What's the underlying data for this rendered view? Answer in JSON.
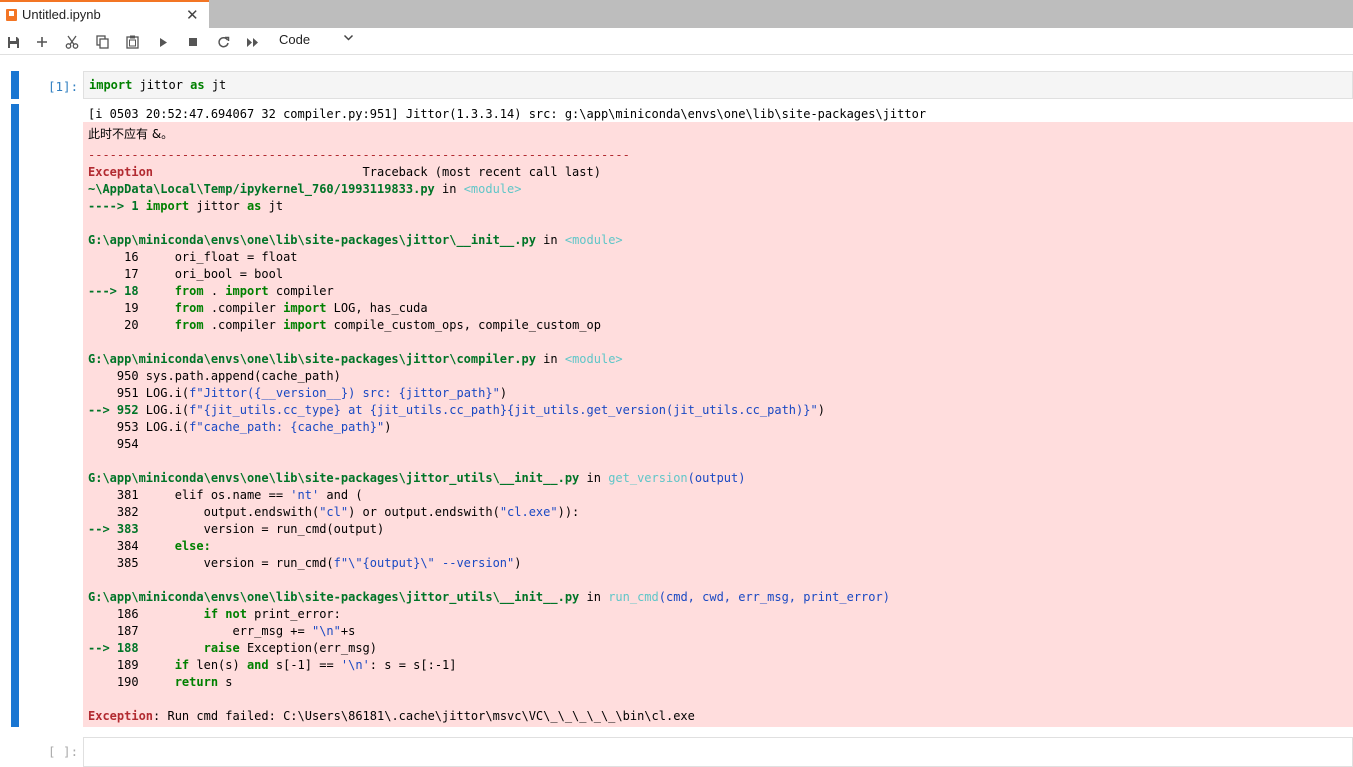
{
  "tab": {
    "title": "Untitled.ipynb",
    "close": "✕"
  },
  "toolbar": {
    "cell_type": "Code",
    "caret": "⌄",
    "icons": [
      "save-icon",
      "add-icon",
      "cut-icon",
      "copy-icon",
      "paste-icon",
      "run-icon",
      "stop-icon",
      "restart-icon",
      "fast-forward-icon"
    ]
  },
  "cell1": {
    "prompt": "[1]:",
    "code_kw1": "import",
    "code_mid": " jittor ",
    "code_kw2": "as",
    "code_end": " jt"
  },
  "output": {
    "stdout": "[i 0503 20:52:47.694067 32 compiler.py:951] Jittor(1.3.3.14) src: g:\\app\\miniconda\\envs\\one\\lib\\site-packages\\jittor",
    "warning": "此时不应有 &。",
    "dashes": "---------------------------------------------------------------------------",
    "exc_name": "Exception",
    "traceback_header": "                             Traceback (most recent call last)",
    "frame1_path": "~\\AppData\\Local\\Temp/ipykernel_760/1993119833.py",
    "frame1_in": " in ",
    "frame1_mod": "<module>",
    "frame1_arrow": "----> 1 ",
    "frame1_code_kw1": "import",
    "frame1_code_mid": " jittor ",
    "frame1_code_kw2": "as",
    "frame1_code_end": " jt",
    "frame2_path": "G:\\app\\miniconda\\envs\\one\\lib\\site-packages\\jittor\\__init__.py",
    "frame2_in": " in ",
    "frame2_mod": "<module>",
    "f2l1": "     16     ori_float = float",
    "f2l2": "     17     ori_bool = bool",
    "f2l3_arrow": "---> 18 ",
    "f2l3_rest_kw": "from",
    "f2l3_mid": " . ",
    "f2l3_kw2": "import",
    "f2l3_end": " compiler",
    "f2l4_pre": "     19     ",
    "f2l4_kw": "from",
    "f2l4_mid": " .compiler ",
    "f2l4_kw2": "import",
    "f2l4_end": " LOG, has_cuda",
    "f2l5_pre": "     20     ",
    "f2l5_kw": "from",
    "f2l5_mid": " .compiler ",
    "f2l5_kw2": "import",
    "f2l5_end": " compile_custom_ops, compile_custom_op",
    "frame3_path": "G:\\app\\miniconda\\envs\\one\\lib\\site-packages\\jittor\\compiler.py",
    "frame3_in": " in ",
    "frame3_mod": "<module>",
    "f3l1": "    950 sys.path.append(cache_path)",
    "f3l2_pre": "    951 LOG.i(",
    "f3l2_str": "f\"Jittor({__version__}) src: {jittor_path}\"",
    "f3l2_end": ")",
    "f3l3_arrow": "--> 952 ",
    "f3l3_pre": "LOG.i(",
    "f3l3_str": "f\"{jit_utils.cc_type} at {jit_utils.cc_path}{jit_utils.get_version(jit_utils.cc_path)}\"",
    "f3l3_end": ")",
    "f3l4_pre": "    953 LOG.i(",
    "f3l4_str": "f\"cache_path: {cache_path}\"",
    "f3l4_end": ")",
    "f3l5": "    954",
    "frame4_path": "G:\\app\\miniconda\\envs\\one\\lib\\site-packages\\jittor_utils\\__init__.py",
    "frame4_in": " in ",
    "frame4_fn": "get_version",
    "frame4_args": "(output)",
    "f4l1_pre": "    381     elif os.name == ",
    "f4l1_str": "'nt'",
    "f4l1_end": " and (",
    "f4l2_pre": "    382         output.endswith(",
    "f4l2_s1": "\"cl\"",
    "f4l2_mid": ") or output.endswith(",
    "f4l2_s2": "\"cl.exe\"",
    "f4l2_end": ")):",
    "f4l3_arrow": "--> 383 ",
    "f4l3_rest": "        version = run_cmd(output)",
    "f4l4_pre": "    384     ",
    "f4l4_kw": "else:",
    "f4l5_pre": "    385         version = run_cmd(",
    "f4l5_str": "f\"\\\"{output}\\\" --version\"",
    "f4l5_end": ")",
    "frame5_path": "G:\\app\\miniconda\\envs\\one\\lib\\site-packages\\jittor_utils\\__init__.py",
    "frame5_in": " in ",
    "frame5_fn": "run_cmd",
    "frame5_args": "(cmd, cwd, err_msg, print_error)",
    "f5l1_pre": "    186         ",
    "f5l1_kw": "if not",
    "f5l1_end": " print_error:",
    "f5l2_pre": "    187             err_msg += ",
    "f5l2_str": "\"\\n\"",
    "f5l2_end": "+s",
    "f5l3_arrow": "--> 188 ",
    "f5l3_kw": "        raise",
    "f5l3_end": " Exception(err_msg)",
    "f5l4_pre": "    189     ",
    "f5l4_kw": "if",
    "f5l4_mid": " len(s) ",
    "f5l4_kw2": "and",
    "f5l4_mid2": " s[-1] == ",
    "f5l4_str": "'\\n'",
    "f5l4_end": ": s = s[:-1]",
    "f5l5_pre": "    190     ",
    "f5l5_kw": "return",
    "f5l5_end": " s",
    "final_name": "Exception",
    "final_msg": ": Run cmd failed: C:\\Users\\86181\\.cache\\jittor\\msvc\\VC\\_\\_\\_\\_\\_\\bin\\cl.exe"
  },
  "cell2": {
    "prompt": "[ ]:"
  }
}
